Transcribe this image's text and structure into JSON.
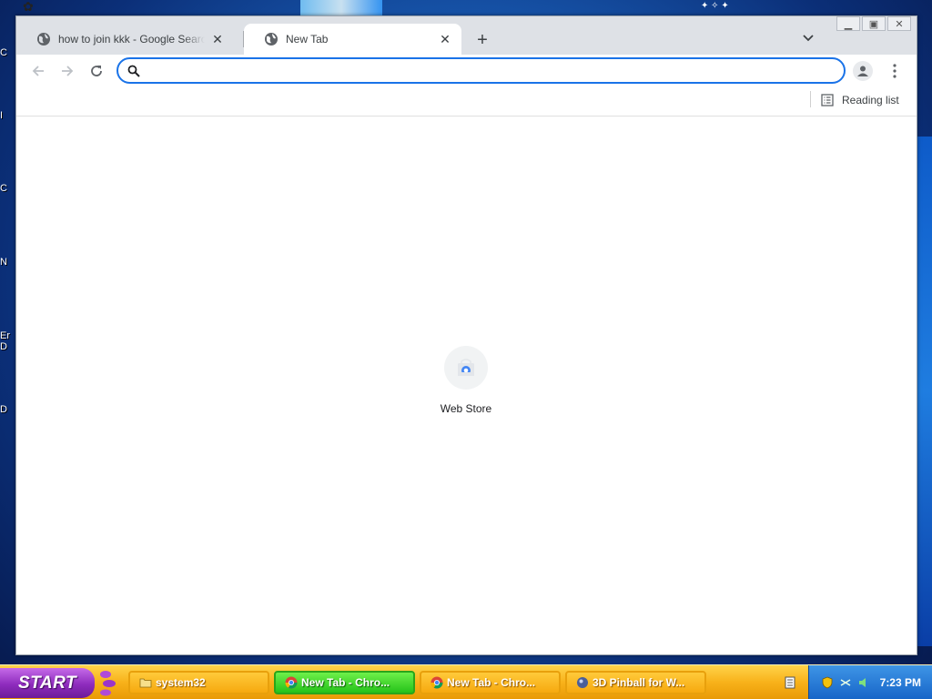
{
  "window": {
    "tabs": [
      {
        "title": "how to join kkk - Google Search",
        "icon": "globe-icon",
        "active": false
      },
      {
        "title": "New Tab",
        "icon": "globe-icon",
        "active": true
      }
    ],
    "caption_buttons": [
      "minimize",
      "restore",
      "close"
    ]
  },
  "toolbar": {
    "omnibox_value": "",
    "omnibox_placeholder": ""
  },
  "bookmarks_bar": {
    "reading_list_label": "Reading list"
  },
  "new_tab_page": {
    "shortcuts": [
      {
        "label": "Web Store",
        "icon": "web-store-icon"
      }
    ]
  },
  "desktop": {
    "icon_label_fragments": [
      "C",
      "I",
      "C",
      "N",
      "Er",
      "D",
      "D"
    ]
  },
  "taskbar": {
    "start_label": "START",
    "buttons": [
      {
        "label": "system32",
        "icon": "folder-icon",
        "active": false
      },
      {
        "label": "New Tab - Chro...",
        "icon": "chrome-icon",
        "active": true
      },
      {
        "label": "New Tab - Chro...",
        "icon": "chrome-icon",
        "active": false
      },
      {
        "label": "3D Pinball for W...",
        "icon": "pinball-icon",
        "active": false
      }
    ],
    "clock": "7:23 PM"
  },
  "colors": {
    "accent": "#1a73e8",
    "taskbar_orange": "#f8b21a",
    "start_purple": "#8e2bbd",
    "active_task_green": "#25c21a",
    "tray_blue": "#1765c8"
  }
}
